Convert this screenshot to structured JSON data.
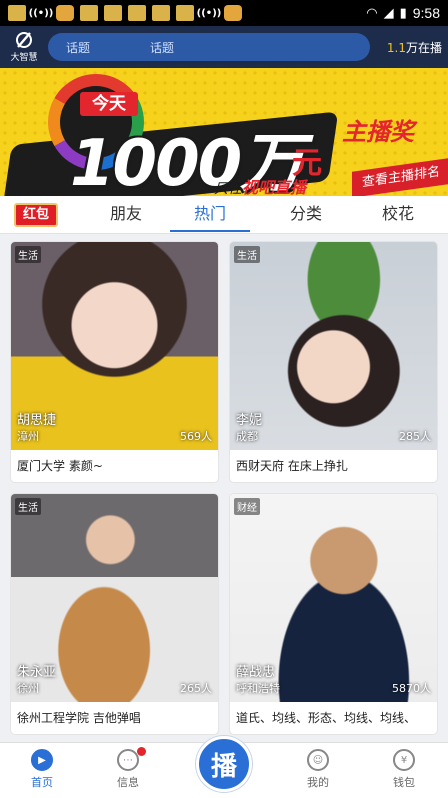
{
  "status_bar": {
    "time": "9:58",
    "notification_icons": [
      "app-icon",
      "radio-icon",
      "face-icon",
      "app-icon",
      "app-icon",
      "app-icon",
      "app-icon",
      "app-icon",
      "radio-icon",
      "face-icon"
    ]
  },
  "header": {
    "logo_text": "大智慧",
    "search_hints": [
      "话题",
      "话题"
    ],
    "live_count_number": "1.1",
    "live_count_suffix": "万在播"
  },
  "banner": {
    "today": "今天",
    "amount": "1000万",
    "unit": "元",
    "prize": "主播奖",
    "slogan_prefix": "只在",
    "slogan_brand": "视吧直播",
    "rank_button": "查看主播排名"
  },
  "tabs": {
    "red_packet": "红包",
    "items": [
      "朋友",
      "热门",
      "分类",
      "校花"
    ],
    "active": "热门"
  },
  "streams": [
    {
      "category": "生活",
      "host": "胡思捷",
      "city": "漳州",
      "viewers": "569人",
      "caption": "厦门大学 素颜~"
    },
    {
      "category": "生活",
      "host": "李妮",
      "city": "成都",
      "viewers": "285人",
      "caption": "西财天府 在床上挣扎"
    },
    {
      "category": "生活",
      "host": "朱永亚",
      "city": "徐州",
      "viewers": "265人",
      "caption": "徐州工程学院 吉他弹唱"
    },
    {
      "category": "财经",
      "host": "薛战忠",
      "city": "呼和浩特",
      "viewers": "5870人",
      "caption": "道氏、均线、形态、均线、均线、"
    }
  ],
  "bottom_nav": {
    "home": "首页",
    "messages": "信息",
    "live": "播",
    "me": "我的",
    "wallet": "钱包"
  },
  "colors": {
    "accent": "#2a6fd6",
    "header_bg": "#1e2c4c",
    "banner_yellow": "#f6d21d",
    "red": "#e3262e"
  }
}
